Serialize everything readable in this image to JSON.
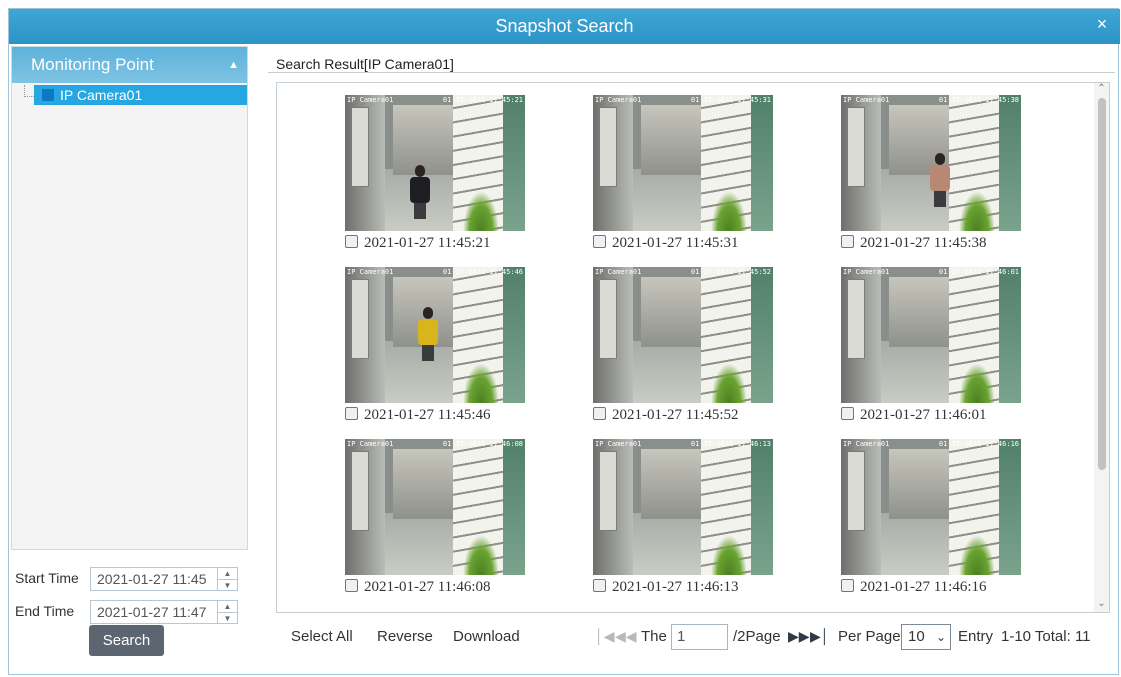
{
  "window": {
    "title": "Snapshot Search",
    "close_label": "×"
  },
  "left": {
    "header": "Monitoring Point",
    "collapse_icon": "chevron-up",
    "tree_items": [
      {
        "label": "IP Camera01"
      }
    ],
    "start_time_label": "Start Time",
    "start_time_value": "2021-01-27 11:45",
    "end_time_label": "End Time",
    "end_time_value": "2021-01-27 11:47",
    "search_label": "Search"
  },
  "result": {
    "title": "Search Result[IP Camera01]",
    "snapshots": [
      {
        "caption": "2021-01-27 11:45:21",
        "osd_left": "IP Camera01",
        "osd_right": "01-27-2021 11:45:21"
      },
      {
        "caption": "2021-01-27 11:45:31",
        "osd_left": "IP Camera01",
        "osd_right": "01-27-2021 11:45:31"
      },
      {
        "caption": "2021-01-27 11:45:38",
        "osd_left": "IP Camera01",
        "osd_right": "01-27-2021 11:45:38"
      },
      {
        "caption": "2021-01-27 11:45:46",
        "osd_left": "IP Camera01",
        "osd_right": "01-27-2021 11:45:46"
      },
      {
        "caption": "2021-01-27 11:45:52",
        "osd_left": "IP Camera01",
        "osd_right": "01-27-2021 11:45:52"
      },
      {
        "caption": "2021-01-27 11:46:01",
        "osd_left": "IP Camera01",
        "osd_right": "01-27-2021 11:46:01"
      },
      {
        "caption": "2021-01-27 11:46:08",
        "osd_left": "IP Camera01",
        "osd_right": "01-27-2021 11:46:08"
      },
      {
        "caption": "2021-01-27 11:46:13",
        "osd_left": "IP Camera01",
        "osd_right": "01-27-2021 11:46:13"
      },
      {
        "caption": "2021-01-27 11:46:16",
        "osd_left": "IP Camera01",
        "osd_right": "01-27-2021 11:46:16"
      }
    ]
  },
  "footer": {
    "select_all": "Select All",
    "reverse": "Reverse",
    "download": "Download",
    "the_label": "The",
    "page_value": "1",
    "page_suffix": "/2Page",
    "per_page_label": "Per Page",
    "per_page_value": "10",
    "entry_label": "Entry",
    "summary": "1-10 Total: 11"
  },
  "colors": {
    "title_bar": "#2b94c6",
    "selected_tree_item": "#26a7e2",
    "search_button": "#5d6670"
  }
}
